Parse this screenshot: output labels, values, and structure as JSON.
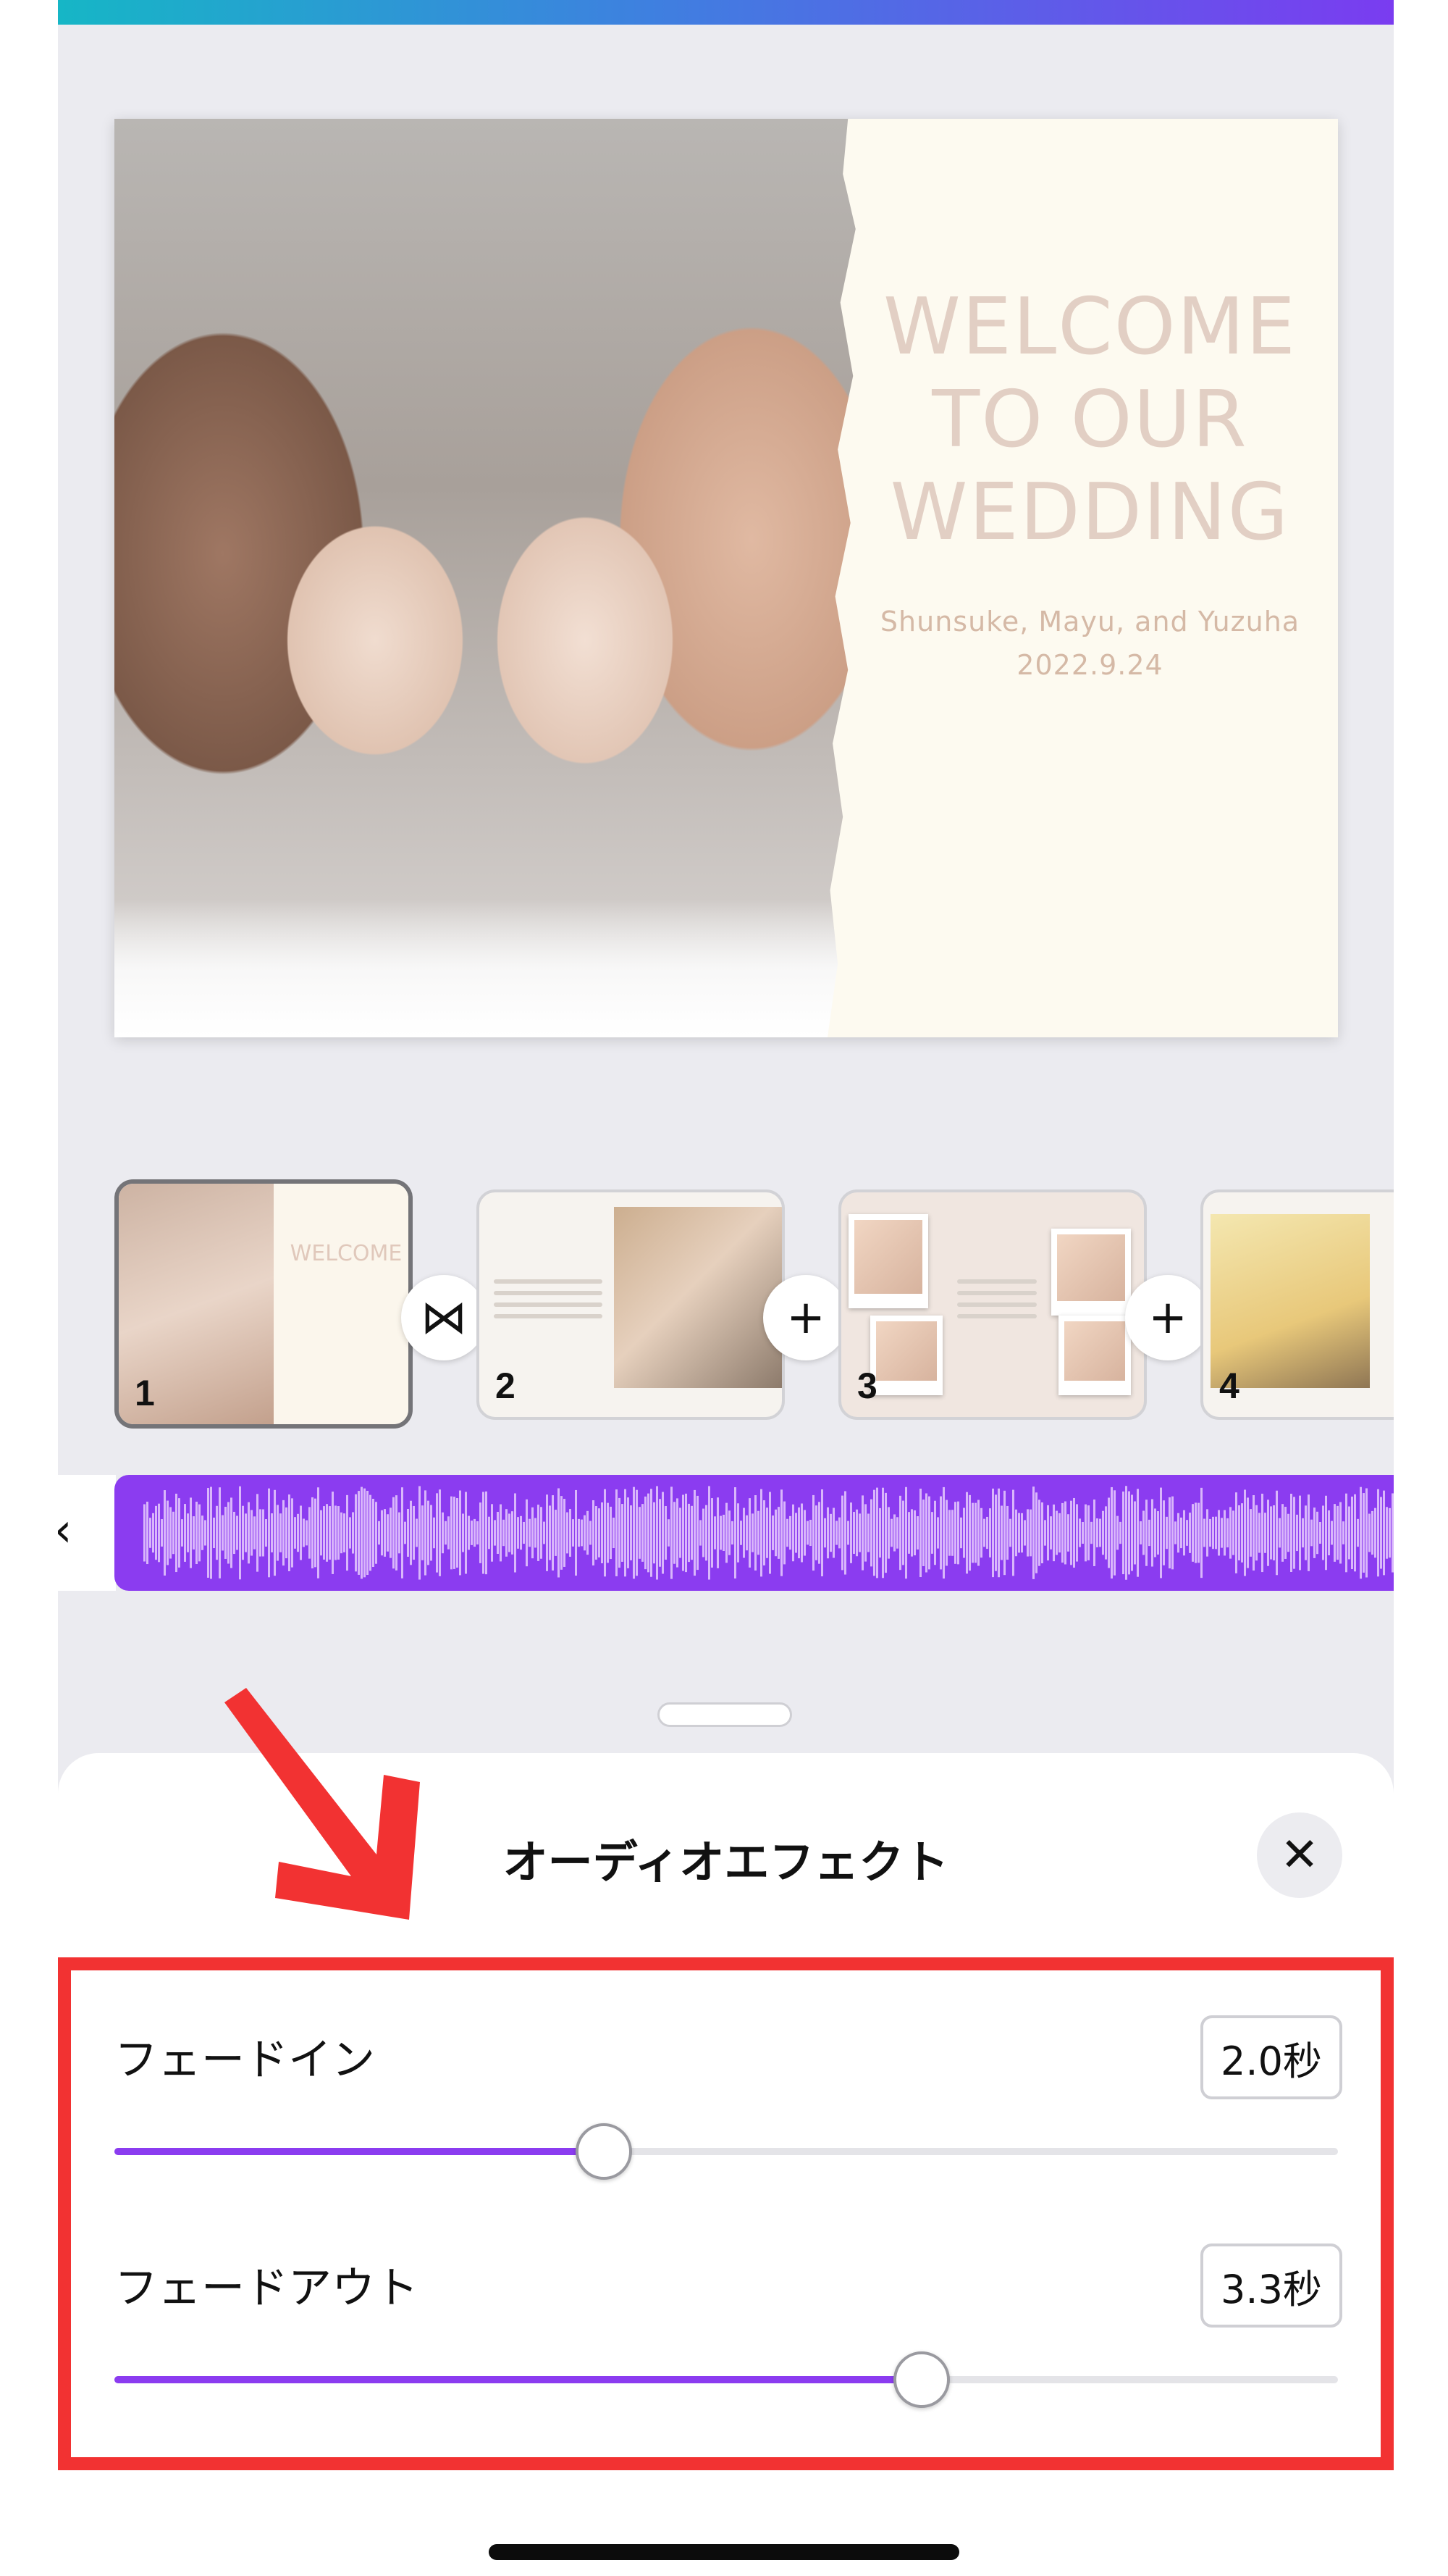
{
  "preview": {
    "title_lines": [
      "WELCOME",
      "TO OUR",
      "WEDDING"
    ],
    "names": "Shunsuke, Mayu, and Yuzuha",
    "date": "2022.9.24"
  },
  "pages": [
    {
      "number": "1",
      "selected": true
    },
    {
      "number": "2",
      "selected": false
    },
    {
      "number": "3",
      "selected": false
    },
    {
      "number": "4",
      "selected": false
    }
  ],
  "connectors": {
    "transition_icon": "⋈",
    "add_icon": "+"
  },
  "audio": {
    "collapse_icon": "‹",
    "track_color": "#8b3cf0"
  },
  "sheet": {
    "title": "オーディオエフェクト",
    "close_icon": "✕",
    "fade_in": {
      "label": "フェードイン",
      "value": "2.0秒",
      "fraction": 0.4
    },
    "fade_out": {
      "label": "フェードアウト",
      "value": "3.3秒",
      "fraction": 0.66
    }
  },
  "colors": {
    "accent": "#8b3cf0",
    "annotation": "#f23232"
  }
}
